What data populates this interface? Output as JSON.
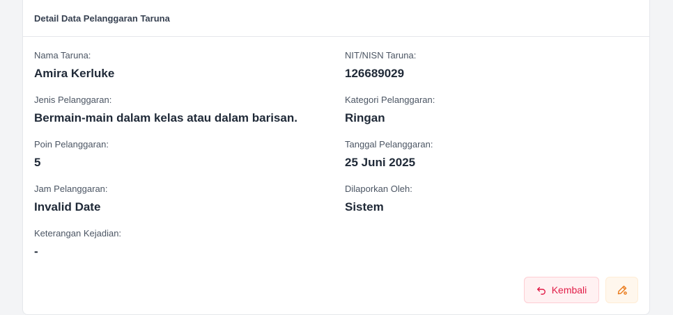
{
  "header": {
    "title": "Detail Data Pelanggaran Taruna"
  },
  "fields": [
    {
      "label": "Nama Taruna:",
      "value": "Amira Kerluke"
    },
    {
      "label": "NIT/NISN Taruna:",
      "value": "126689029"
    },
    {
      "label": "Jenis Pelanggaran:",
      "value": "Bermain-main dalam kelas atau dalam barisan."
    },
    {
      "label": "Kategori Pelanggaran:",
      "value": "Ringan"
    },
    {
      "label": "Poin Pelanggaran:",
      "value": "5"
    },
    {
      "label": "Tanggal Pelanggaran:",
      "value": "25 Juni 2025"
    },
    {
      "label": "Jam Pelanggaran:",
      "value": "Invalid Date"
    },
    {
      "label": "Dilaporkan Oleh:",
      "value": "Sistem"
    },
    {
      "label": "Keterangan Kejadian:",
      "value": "-"
    }
  ],
  "actions": {
    "back_label": "Kembali",
    "back_icon": "return-arrow-icon",
    "edit_icon": "pencil-edit-icon"
  },
  "colors": {
    "back_text": "#e11d48",
    "back_bg": "#fff1f2",
    "edit_icon": "#ea7b1c",
    "edit_bg": "#fff7ed"
  }
}
